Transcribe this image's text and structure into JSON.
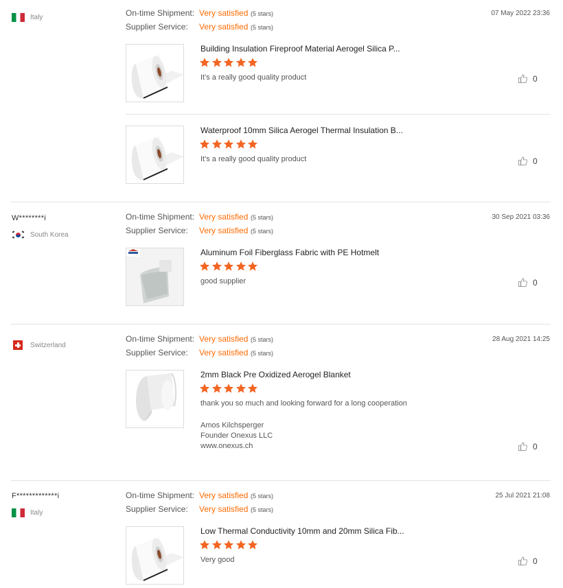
{
  "labels": {
    "on_time_shipment": "On-time Shipment:",
    "supplier_service": "Supplier Service:"
  },
  "colors": {
    "accent": "#ff6a00",
    "star": "#f26522"
  },
  "reviews": [
    {
      "buyer_name": "",
      "country": "Italy",
      "flag": "italy-flag-icon",
      "date": "07 May 2022 23:36",
      "shipment_value": "Very satisfied",
      "shipment_stars": "(5 stars)",
      "service_value": "Very satisfied",
      "service_stars": "(5 stars)",
      "items": [
        {
          "product": "Building Insulation Fireproof Material Aerogel Silica P...",
          "rating": 5,
          "comment": "It's a really good quality product",
          "likes": "0",
          "thumb": "white-roll-icon"
        },
        {
          "product": "Waterproof 10mm Silica Aerogel Thermal Insulation B...",
          "rating": 5,
          "comment": "It's a really good quality product",
          "likes": "0",
          "thumb": "white-roll-icon"
        }
      ]
    },
    {
      "buyer_name": "W********i",
      "country": "South Korea",
      "flag": "korea-flag-icon",
      "date": "30 Sep 2021 03:36",
      "shipment_value": "Very satisfied",
      "shipment_stars": "(5 stars)",
      "service_value": "Very satisfied",
      "service_stars": "(5 stars)",
      "items": [
        {
          "product": "Aluminum Foil Fiberglass Fabric with PE Hotmelt",
          "rating": 5,
          "comment": "good supplier",
          "likes": "0",
          "thumb": "foil-fabric-icon"
        }
      ]
    },
    {
      "buyer_name": "",
      "country": "Switzerland",
      "flag": "switzerland-flag-icon",
      "date": "28 Aug 2021 14:25",
      "shipment_value": "Very satisfied",
      "shipment_stars": "(5 stars)",
      "service_value": "Very satisfied",
      "service_stars": "(5 stars)",
      "items": [
        {
          "product": "2mm Black Pre Oxidized Aerogel Blanket",
          "rating": 5,
          "comment": "thank you so much and looking forward for a long cooperation",
          "signature": [
            "Amos Kilchsperger",
            "Founder Onexus LLC",
            "www.onexus.ch"
          ],
          "likes": "0",
          "thumb": "white-sheet-icon"
        }
      ]
    },
    {
      "buyer_name": "F*************i",
      "country": "Italy",
      "flag": "italy-flag-icon",
      "date": "25 Jul 2021 21:08",
      "shipment_value": "Very satisfied",
      "shipment_stars": "(5 stars)",
      "service_value": "Very satisfied",
      "service_stars": "(5 stars)",
      "items": [
        {
          "product": "Low Thermal Conductivity 10mm and 20mm Silica Fib...",
          "rating": 5,
          "comment": "Very good",
          "likes": "0",
          "thumb": "white-roll-icon"
        }
      ]
    }
  ]
}
